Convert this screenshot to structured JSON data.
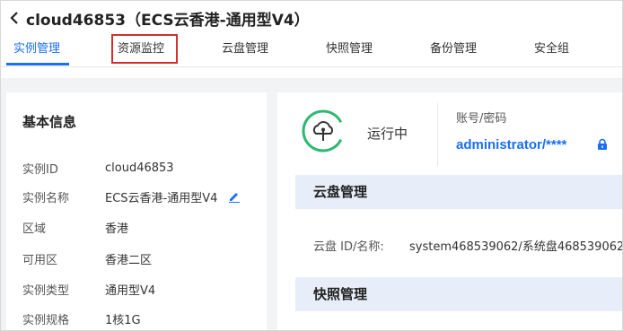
{
  "header": {
    "title": "cloud46853（ECS云香港-通用型V4）"
  },
  "tabs": [
    {
      "label": "实例管理",
      "active": true
    },
    {
      "label": "资源监控",
      "highlighted": true
    },
    {
      "label": "云盘管理"
    },
    {
      "label": "快照管理"
    },
    {
      "label": "备份管理"
    },
    {
      "label": "安全组"
    }
  ],
  "basic_info": {
    "title": "基本信息",
    "rows": [
      {
        "label": "实例ID",
        "value": "cloud46853"
      },
      {
        "label": "实例名称",
        "value": "ECS云香港-通用型V4"
      },
      {
        "label": "区域",
        "value": "香港"
      },
      {
        "label": "可用区",
        "value": "香港二区"
      },
      {
        "label": "实例类型",
        "value": "通用型V4"
      },
      {
        "label": "实例规格",
        "value": "1核1G"
      }
    ]
  },
  "status": {
    "text": "运行中",
    "color": "#2eb872"
  },
  "account": {
    "label": "账号/密码",
    "value": "administrator/****"
  },
  "disk_section": {
    "title": "云盘管理",
    "label": "云盘 ID/名称:",
    "value": "system468539062/系统盘468539062"
  },
  "snapshot_section": {
    "title": "快照管理"
  },
  "colors": {
    "accent": "#1a6ef5",
    "highlight_box": "#d32f2f",
    "section_bg": "#e8eef9",
    "page_bg": "#f2f3f5"
  },
  "icons": {
    "back": "chevron-left-icon",
    "edit": "pencil-icon",
    "lock": "lock-icon",
    "status": "cloud-power-icon"
  }
}
